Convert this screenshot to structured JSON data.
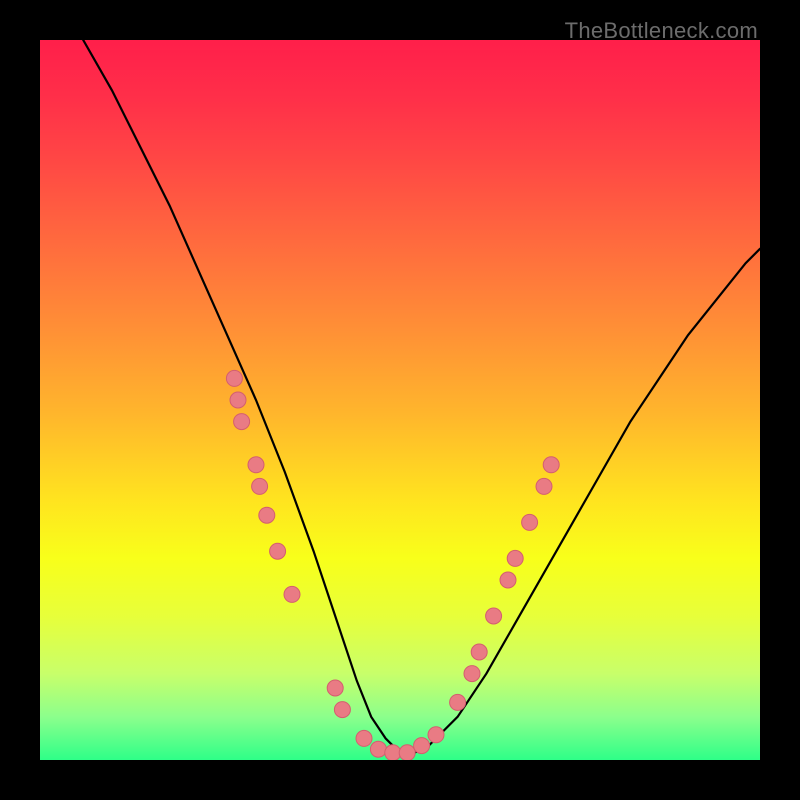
{
  "watermark": "TheBottleneck.com",
  "colors": {
    "dot_fill": "#e97b84",
    "dot_stroke": "#d45e6f",
    "curve": "#000000",
    "frame": "#000000",
    "gradient": [
      "#ff1f4a",
      "#ff4545",
      "#ff8f36",
      "#ffe41f",
      "#c8ff6a",
      "#2eff88"
    ]
  },
  "chart_data": {
    "type": "line",
    "title": "",
    "xlabel": "",
    "ylabel": "",
    "xlim": [
      0,
      100
    ],
    "ylim": [
      0,
      100
    ],
    "series": [
      {
        "name": "curve",
        "x": [
          6,
          10,
          14,
          18,
          22,
          26,
          30,
          34,
          38,
          40,
          42,
          44,
          46,
          48,
          50,
          52,
          54,
          58,
          62,
          66,
          70,
          74,
          78,
          82,
          86,
          90,
          94,
          98,
          100
        ],
        "y": [
          100,
          93,
          85,
          77,
          68,
          59,
          50,
          40,
          29,
          23,
          17,
          11,
          6,
          3,
          1,
          1,
          2,
          6,
          12,
          19,
          26,
          33,
          40,
          47,
          53,
          59,
          64,
          69,
          71
        ]
      }
    ],
    "points": [
      {
        "name": "left-cluster",
        "xy": [
          [
            27,
            53
          ],
          [
            27.5,
            50
          ],
          [
            28,
            47
          ],
          [
            30,
            41
          ],
          [
            30.5,
            38
          ],
          [
            31.5,
            34
          ],
          [
            33,
            29
          ],
          [
            35,
            23
          ]
        ]
      },
      {
        "name": "valley-cluster",
        "xy": [
          [
            41,
            10
          ],
          [
            42,
            7
          ],
          [
            45,
            3
          ],
          [
            47,
            1.5
          ],
          [
            49,
            1
          ],
          [
            51,
            1
          ],
          [
            53,
            2
          ],
          [
            55,
            3.5
          ]
        ]
      },
      {
        "name": "right-cluster",
        "xy": [
          [
            58,
            8
          ],
          [
            60,
            12
          ],
          [
            61,
            15
          ],
          [
            63,
            20
          ],
          [
            65,
            25
          ],
          [
            66,
            28
          ],
          [
            68,
            33
          ],
          [
            70,
            38
          ],
          [
            71,
            41
          ]
        ]
      }
    ]
  }
}
